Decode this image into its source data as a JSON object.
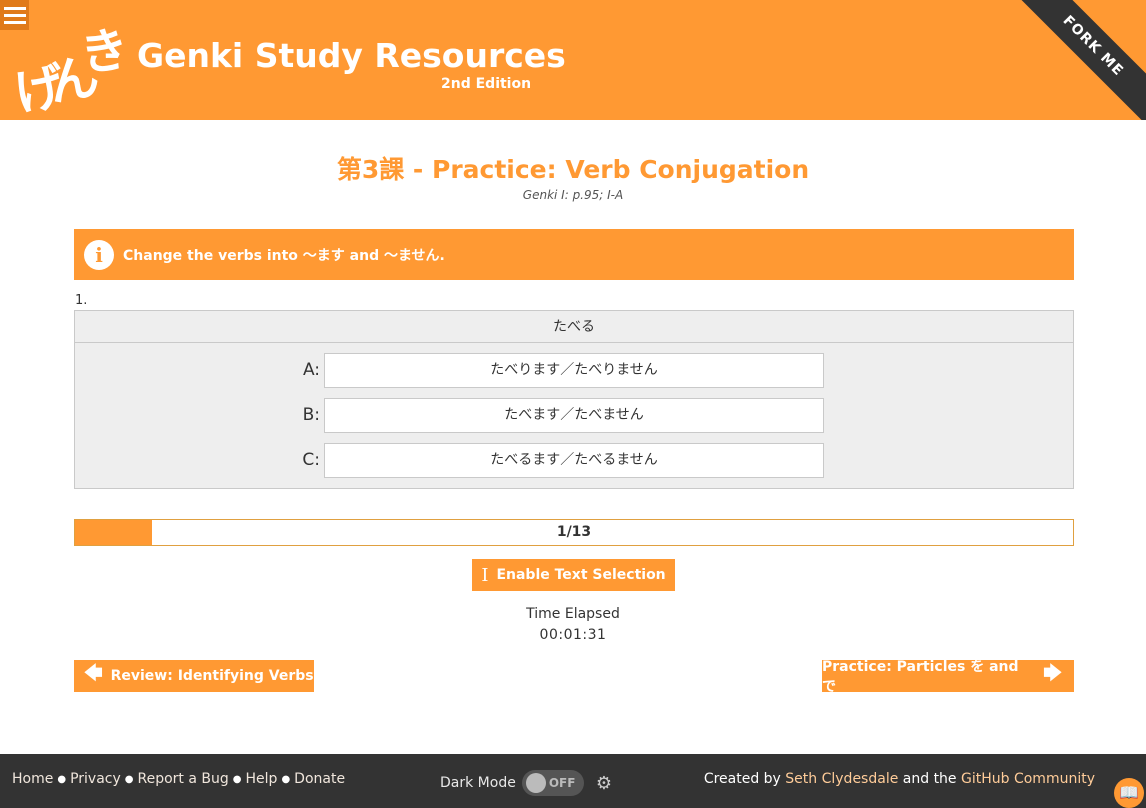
{
  "header": {
    "logo_kana": [
      "げ",
      "ん",
      "き"
    ],
    "title": "Genki Study Resources",
    "edition": "2nd Edition",
    "fork_ribbon": "FORK ME"
  },
  "lesson": {
    "title": "第3課 - Practice: Verb Conjugation",
    "reference": "Genki I: p.95; I-A"
  },
  "instruction": {
    "icon": "info-icon",
    "text": "Change the verbs into ～ます and ～ません."
  },
  "question": {
    "number": "1.",
    "word": "たべる",
    "answers": [
      {
        "letter": "A:",
        "text": "たべります／たべりません"
      },
      {
        "letter": "B:",
        "text": "たべます／たべません"
      },
      {
        "letter": "C:",
        "text": "たべるます／たべるません"
      }
    ]
  },
  "progress": {
    "label": "1/13",
    "current": 1,
    "total": 13
  },
  "controls": {
    "text_selection_label": "Enable Text Selection",
    "time_label": "Time Elapsed",
    "time_value": "00:01:31"
  },
  "navigation": {
    "prev_label": "Review: Identifying Verbs",
    "next_label": "Practice: Particles を and で"
  },
  "footer": {
    "links": [
      "Home",
      "Privacy",
      "Report a Bug",
      "Help",
      "Donate"
    ],
    "dark_mode_label": "Dark Mode",
    "dark_mode_state": "OFF",
    "credits_prefix": "Created by",
    "credits_author": "Seth Clydesdale",
    "credits_mid": "and the",
    "credits_community": "GitHub Community"
  },
  "colors": {
    "accent": "#ff9933",
    "footer_bg": "#333333",
    "panel_bg": "#eeeeee"
  }
}
